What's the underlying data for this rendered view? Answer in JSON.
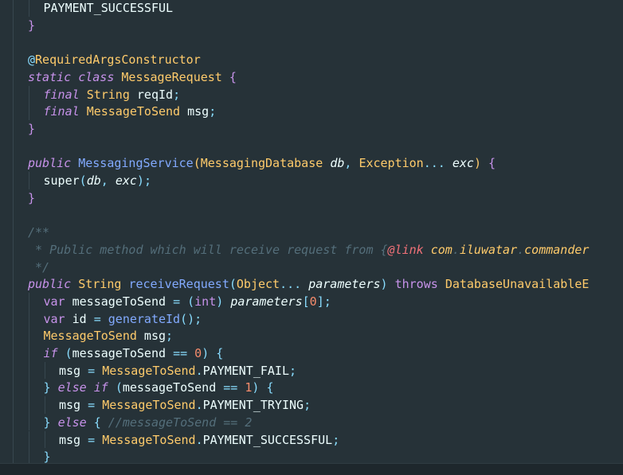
{
  "editor": {
    "language": "java",
    "theme_colors": {
      "background": "#263238",
      "plain": "#eeffff",
      "keyword": "#c792ea",
      "type": "#ffcb6b",
      "function": "#82aaff",
      "punctuation": "#89ddff",
      "number": "#f78c6c",
      "comment": "#546e7a",
      "doc_tag": "#f07178"
    },
    "lines": [
      {
        "indent": 1,
        "tokens": [
          [
            "PAYMENT_SUCCESSFUL",
            "plain"
          ]
        ]
      },
      {
        "indent": 0,
        "tokens": [
          [
            "}",
            "bracket"
          ]
        ]
      },
      {
        "indent": 0,
        "tokens": []
      },
      {
        "indent": 0,
        "tokens": [
          [
            "@",
            "punc"
          ],
          [
            "RequiredArgsConstructor",
            "ann"
          ]
        ]
      },
      {
        "indent": 0,
        "tokens": [
          [
            "static",
            "kw-it"
          ],
          [
            " ",
            "plain"
          ],
          [
            "class",
            "kw-it"
          ],
          [
            " ",
            "plain"
          ],
          [
            "MessageRequest",
            "type"
          ],
          [
            " ",
            "plain"
          ],
          [
            "{",
            "bracket"
          ]
        ]
      },
      {
        "indent": 1,
        "tokens": [
          [
            "final",
            "kw-it"
          ],
          [
            " ",
            "plain"
          ],
          [
            "String",
            "type"
          ],
          [
            " reqId",
            "plain"
          ],
          [
            ";",
            "punc"
          ]
        ]
      },
      {
        "indent": 1,
        "tokens": [
          [
            "final",
            "kw-it"
          ],
          [
            " ",
            "plain"
          ],
          [
            "MessageToSend",
            "type"
          ],
          [
            " msg",
            "plain"
          ],
          [
            ";",
            "punc"
          ]
        ]
      },
      {
        "indent": 0,
        "tokens": [
          [
            "}",
            "bracket"
          ]
        ]
      },
      {
        "indent": 0,
        "tokens": []
      },
      {
        "indent": 0,
        "tokens": [
          [
            "public",
            "kw-it"
          ],
          [
            " ",
            "plain"
          ],
          [
            "MessagingService",
            "fn"
          ],
          [
            "(",
            "brace"
          ],
          [
            "MessagingDatabase",
            "type"
          ],
          [
            " ",
            "plain"
          ],
          [
            "db",
            "param"
          ],
          [
            ", ",
            "punc"
          ],
          [
            "Exception",
            "type"
          ],
          [
            "...",
            "punc"
          ],
          [
            " ",
            "plain"
          ],
          [
            "exc",
            "param"
          ],
          [
            ")",
            "brace"
          ],
          [
            " ",
            "plain"
          ],
          [
            "{",
            "bracket"
          ]
        ]
      },
      {
        "indent": 1,
        "tokens": [
          [
            "super",
            "plain"
          ],
          [
            "(",
            "punc"
          ],
          [
            "db",
            "param"
          ],
          [
            ", ",
            "punc"
          ],
          [
            "exc",
            "param"
          ],
          [
            ")",
            "punc"
          ],
          [
            ";",
            "punc"
          ]
        ]
      },
      {
        "indent": 0,
        "tokens": [
          [
            "}",
            "bracket"
          ]
        ]
      },
      {
        "indent": 0,
        "tokens": []
      },
      {
        "indent": 0,
        "tokens": [
          [
            "/**",
            "comment"
          ]
        ]
      },
      {
        "indent": 0,
        "tokens": [
          [
            " * Public method which will receive request from ",
            "comment"
          ],
          [
            "{",
            "comment"
          ],
          [
            "@link",
            "doc-tag"
          ],
          [
            " com",
            "doc-ref"
          ],
          [
            ".",
            "comment"
          ],
          [
            "iluwatar",
            "doc-ref"
          ],
          [
            ".",
            "comment"
          ],
          [
            "commander",
            "doc-ref"
          ]
        ]
      },
      {
        "indent": 0,
        "tokens": [
          [
            " */",
            "comment"
          ]
        ]
      },
      {
        "indent": 0,
        "tokens": [
          [
            "public",
            "kw-it"
          ],
          [
            " ",
            "plain"
          ],
          [
            "String",
            "type"
          ],
          [
            " ",
            "plain"
          ],
          [
            "receiveRequest",
            "fn"
          ],
          [
            "(",
            "punc"
          ],
          [
            "Object",
            "type"
          ],
          [
            "...",
            "punc"
          ],
          [
            " ",
            "plain"
          ],
          [
            "parameters",
            "param"
          ],
          [
            ")",
            "punc"
          ],
          [
            " ",
            "plain"
          ],
          [
            "throws",
            "kw"
          ],
          [
            " ",
            "plain"
          ],
          [
            "DatabaseUnavailableE",
            "type"
          ]
        ]
      },
      {
        "indent": 1,
        "tokens": [
          [
            "var",
            "kw"
          ],
          [
            " messageToSend ",
            "plain"
          ],
          [
            "=",
            "punc"
          ],
          [
            " ",
            "plain"
          ],
          [
            "(",
            "punc"
          ],
          [
            "int",
            "kw"
          ],
          [
            ")",
            "punc"
          ],
          [
            " ",
            "plain"
          ],
          [
            "parameters",
            "param"
          ],
          [
            "[",
            "punc"
          ],
          [
            "0",
            "num"
          ],
          [
            "]",
            "punc"
          ],
          [
            ";",
            "punc"
          ]
        ]
      },
      {
        "indent": 1,
        "tokens": [
          [
            "var",
            "kw"
          ],
          [
            " id ",
            "plain"
          ],
          [
            "=",
            "punc"
          ],
          [
            " ",
            "plain"
          ],
          [
            "generateId",
            "fn"
          ],
          [
            "()",
            "punc"
          ],
          [
            ";",
            "punc"
          ]
        ]
      },
      {
        "indent": 1,
        "tokens": [
          [
            "MessageToSend",
            "type"
          ],
          [
            " msg",
            "plain"
          ],
          [
            ";",
            "punc"
          ]
        ]
      },
      {
        "indent": 1,
        "tokens": [
          [
            "if",
            "kw-it"
          ],
          [
            " ",
            "plain"
          ],
          [
            "(",
            "punc"
          ],
          [
            "messageToSend ",
            "plain"
          ],
          [
            "==",
            "punc"
          ],
          [
            " ",
            "plain"
          ],
          [
            "0",
            "num"
          ],
          [
            ")",
            "punc"
          ],
          [
            " ",
            "plain"
          ],
          [
            "{",
            "punc"
          ]
        ]
      },
      {
        "indent": 2,
        "tokens": [
          [
            "msg ",
            "plain"
          ],
          [
            "=",
            "punc"
          ],
          [
            " ",
            "plain"
          ],
          [
            "MessageToSend",
            "type"
          ],
          [
            ".",
            "punc"
          ],
          [
            "PAYMENT_FAIL",
            "plain"
          ],
          [
            ";",
            "punc"
          ]
        ]
      },
      {
        "indent": 1,
        "tokens": [
          [
            "}",
            "punc"
          ],
          [
            " ",
            "plain"
          ],
          [
            "else",
            "kw-it"
          ],
          [
            " ",
            "plain"
          ],
          [
            "if",
            "kw-it"
          ],
          [
            " ",
            "plain"
          ],
          [
            "(",
            "punc"
          ],
          [
            "messageToSend ",
            "plain"
          ],
          [
            "==",
            "punc"
          ],
          [
            " ",
            "plain"
          ],
          [
            "1",
            "num"
          ],
          [
            ")",
            "punc"
          ],
          [
            " ",
            "plain"
          ],
          [
            "{",
            "punc"
          ]
        ]
      },
      {
        "indent": 2,
        "tokens": [
          [
            "msg ",
            "plain"
          ],
          [
            "=",
            "punc"
          ],
          [
            " ",
            "plain"
          ],
          [
            "MessageToSend",
            "type"
          ],
          [
            ".",
            "punc"
          ],
          [
            "PAYMENT_TRYING",
            "plain"
          ],
          [
            ";",
            "punc"
          ]
        ]
      },
      {
        "indent": 1,
        "tokens": [
          [
            "}",
            "punc"
          ],
          [
            " ",
            "plain"
          ],
          [
            "else",
            "kw-it"
          ],
          [
            " ",
            "plain"
          ],
          [
            "{",
            "punc"
          ],
          [
            " ",
            "plain"
          ],
          [
            "//messageToSend == 2",
            "comment"
          ]
        ]
      },
      {
        "indent": 2,
        "tokens": [
          [
            "msg ",
            "plain"
          ],
          [
            "=",
            "punc"
          ],
          [
            " ",
            "plain"
          ],
          [
            "MessageToSend",
            "type"
          ],
          [
            ".",
            "punc"
          ],
          [
            "PAYMENT_SUCCESSFUL",
            "plain"
          ],
          [
            ";",
            "punc"
          ]
        ]
      },
      {
        "indent": 1,
        "tokens": [
          [
            "}",
            "punc"
          ]
        ]
      }
    ]
  }
}
